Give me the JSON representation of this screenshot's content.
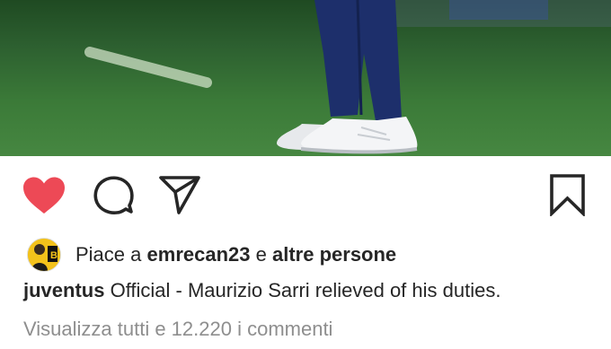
{
  "post": {
    "image_alt": "",
    "likes": {
      "prefix": "Piace a",
      "user": "emrecan23",
      "middle": "e",
      "suffix": "altre persone"
    },
    "caption": {
      "username": "juventus",
      "text": "Official - Maurizio Sarri relieved of his duties."
    },
    "comments_link": "Visualizza tutti e 12.220 i commenti"
  },
  "actions": {
    "like_icon": "heart-filled-icon",
    "comment_icon": "comment-bubble-icon",
    "share_icon": "send-arrow-icon",
    "save_icon": "bookmark-icon"
  },
  "colors": {
    "like": "#ed4956",
    "text": "#262626",
    "muted": "#8e8e8e"
  }
}
